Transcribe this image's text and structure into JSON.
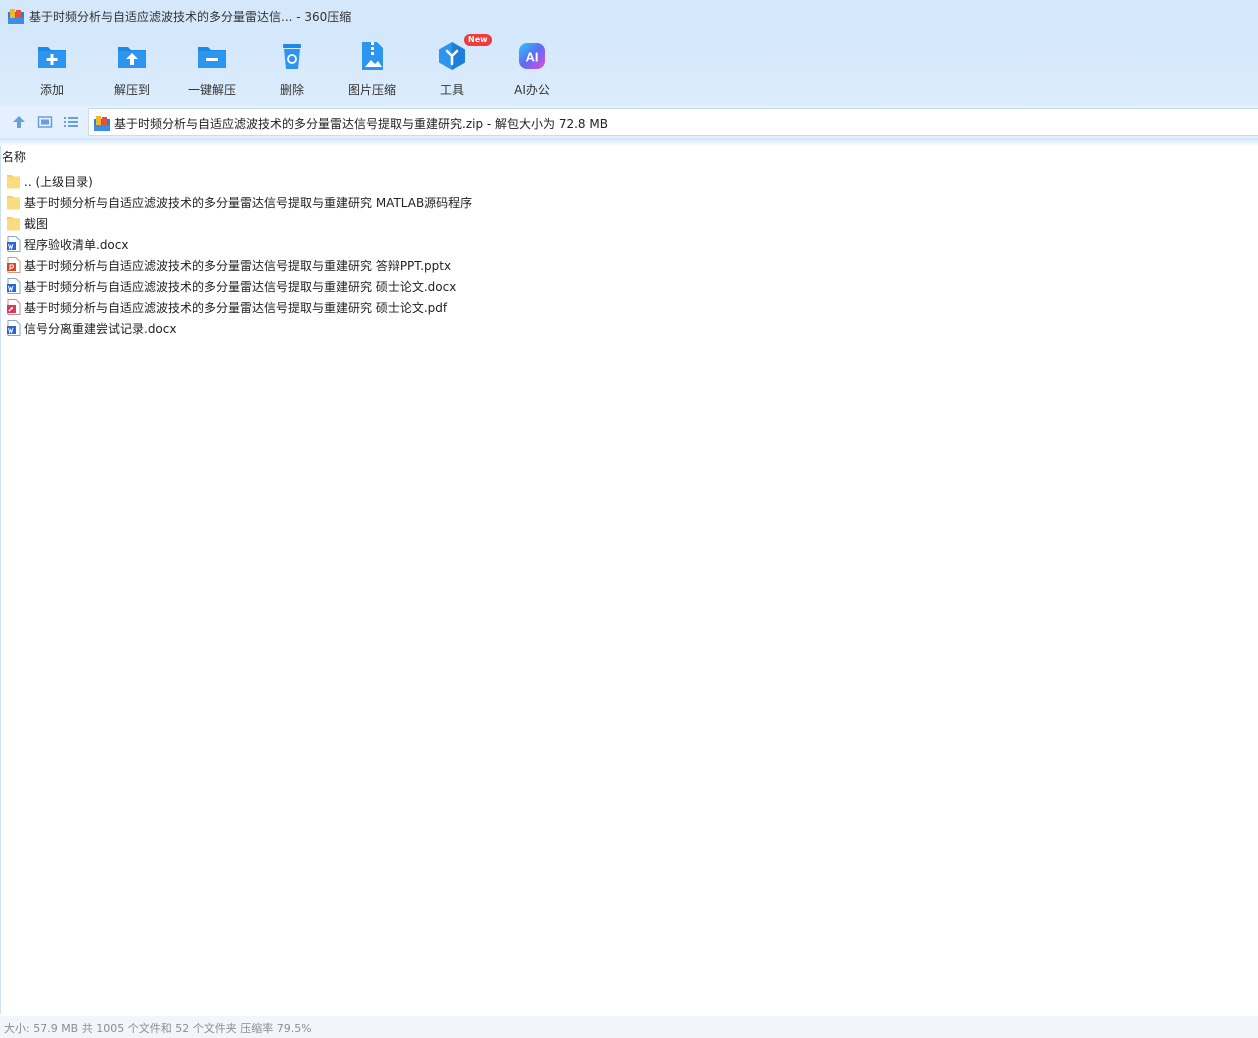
{
  "window": {
    "title": "基于时频分析与自适应滤波技术的多分量雷达信... - 360压缩"
  },
  "toolbar": {
    "items": [
      {
        "label": "添加",
        "icon": "add-icon"
      },
      {
        "label": "解压到",
        "icon": "extract-to-icon"
      },
      {
        "label": "一键解压",
        "icon": "one-click-extract-icon"
      },
      {
        "label": "删除",
        "icon": "delete-icon"
      },
      {
        "label": "图片压缩",
        "icon": "image-compress-icon"
      },
      {
        "label": "工具",
        "icon": "tools-icon",
        "badge": "New"
      },
      {
        "label": "AI办公",
        "icon": "ai-office-icon",
        "icon_text": "AI"
      }
    ]
  },
  "addressbar": {
    "path": "基于时频分析与自适应滤波技术的多分量雷达信号提取与重建研究.zip - 解包大小为 72.8 MB"
  },
  "filelist": {
    "column_name": "名称",
    "rows": [
      {
        "name": ".. (上级目录)",
        "type": "folder"
      },
      {
        "name": "基于时频分析与自适应滤波技术的多分量雷达信号提取与重建研究 MATLAB源码程序",
        "type": "folder"
      },
      {
        "name": "截图",
        "type": "folder"
      },
      {
        "name": "程序验收清单.docx",
        "type": "word"
      },
      {
        "name": "基于时频分析与自适应滤波技术的多分量雷达信号提取与重建研究 答辩PPT.pptx",
        "type": "ppt"
      },
      {
        "name": "基于时频分析与自适应滤波技术的多分量雷达信号提取与重建研究 硕士论文.docx",
        "type": "word"
      },
      {
        "name": "基于时频分析与自适应滤波技术的多分量雷达信号提取与重建研究 硕士论文.pdf",
        "type": "pdf"
      },
      {
        "name": "信号分离重建尝试记录.docx",
        "type": "word"
      }
    ]
  },
  "statusbar": {
    "text": "大小: 57.9 MB 共 1005 个文件和 52 个文件夹 压缩率 79.5%"
  },
  "colors": {
    "accent": "#1e88e5",
    "folder": "#f7d774",
    "word": "#2b66d9",
    "ppt": "#d9472b",
    "pdf": "#d93a55",
    "badge": "#ef3b3b"
  }
}
